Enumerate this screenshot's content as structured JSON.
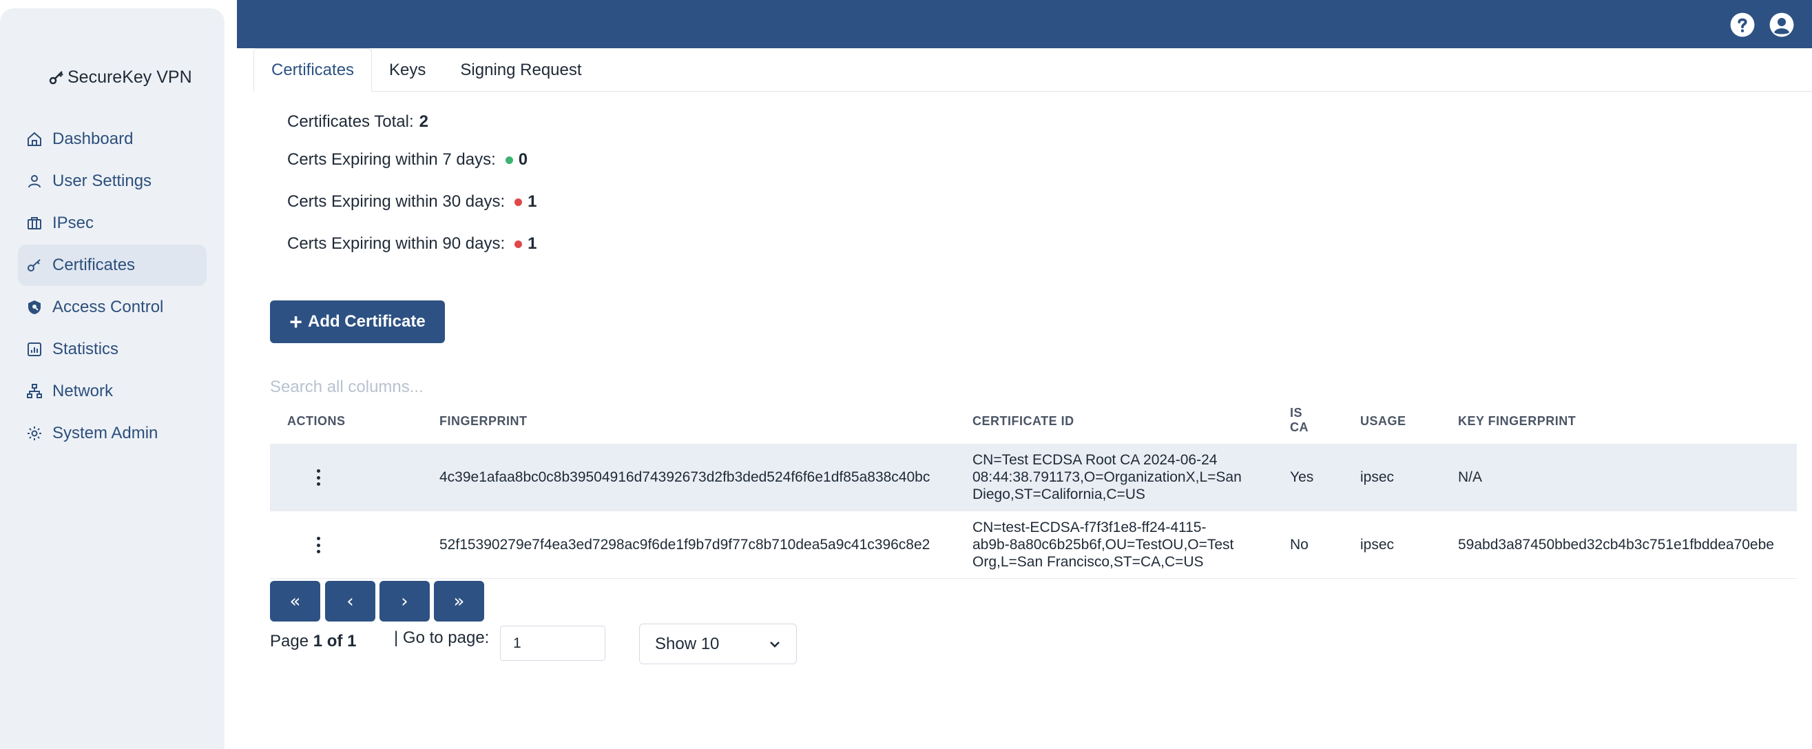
{
  "brand": {
    "name": "SecureKey VPN",
    "icon": "key-icon"
  },
  "sidebar": {
    "items": [
      {
        "label": "Dashboard",
        "icon": "home-icon"
      },
      {
        "label": "User Settings",
        "icon": "user-icon"
      },
      {
        "label": "IPsec",
        "icon": "briefcase-icon"
      },
      {
        "label": "Certificates",
        "icon": "key-icon",
        "active": true
      },
      {
        "label": "Access Control",
        "icon": "shield-icon"
      },
      {
        "label": "Statistics",
        "icon": "chart-icon"
      },
      {
        "label": "Network",
        "icon": "network-icon"
      },
      {
        "label": "System Admin",
        "icon": "gear-icon"
      }
    ]
  },
  "topbar": {
    "icons": [
      "help-icon",
      "account-icon"
    ]
  },
  "tabs": [
    {
      "label": "Certificates",
      "active": true
    },
    {
      "label": "Keys"
    },
    {
      "label": "Signing Request"
    }
  ],
  "stats": {
    "total_label": "Certificates Total:",
    "total_value": "2",
    "exp7_label": "Certs Expiring within 7 days:",
    "exp7_value": "0",
    "exp7_color": "#3cb371",
    "exp30_label": "Certs Expiring within 30 days:",
    "exp30_value": "1",
    "exp30_color": "#e04848",
    "exp90_label": "Certs Expiring within 90 days:",
    "exp90_value": "1",
    "exp90_color": "#e04848"
  },
  "add_button": {
    "label": "Add Certificate"
  },
  "search": {
    "placeholder": "Search all columns..."
  },
  "table": {
    "headers": {
      "actions": "ACTIONS",
      "fingerprint": "FINGERPRINT",
      "certificate_id": "CERTIFICATE ID",
      "is_ca_1": "IS",
      "is_ca_2": "CA",
      "usage": "USAGE",
      "key_fingerprint": "KEY FINGERPRINT"
    },
    "rows": [
      {
        "fingerprint": "4c39e1afaa8bc0c8b39504916d74392673d2fb3ded524f6f6e1df85a838c40bc",
        "cert_id_1": "CN=Test ECDSA Root CA 2024-06-24",
        "cert_id_2": "08:44:38.791173,O=OrganizationX,L=San",
        "cert_id_3": "Diego,ST=California,C=US",
        "is_ca": "Yes",
        "usage": "ipsec",
        "key_fingerprint": "N/A"
      },
      {
        "fingerprint": "52f15390279e7f4ea3ed7298ac9f6de1f9b7d9f77c8b710dea5a9c41c396c8e2",
        "cert_id_1": "CN=test-ECDSA-f7f3f1e8-ff24-4115-",
        "cert_id_2": "ab9b-8a80c6b25b6f,OU=TestOU,O=Test",
        "cert_id_3": "Org,L=San Francisco,ST=CA,C=US",
        "is_ca": "No",
        "usage": "ipsec",
        "key_fingerprint": "59abd3a87450bbed32cb4b3c751e1fbddea70ebe"
      }
    ]
  },
  "pagination": {
    "first": "«",
    "prev": "‹",
    "next": "›",
    "last": "»",
    "page_label": "Page",
    "page_value": "1 of 1",
    "goto_label": "| Go to page:",
    "goto_value": "1",
    "show_label": "Show 10"
  }
}
